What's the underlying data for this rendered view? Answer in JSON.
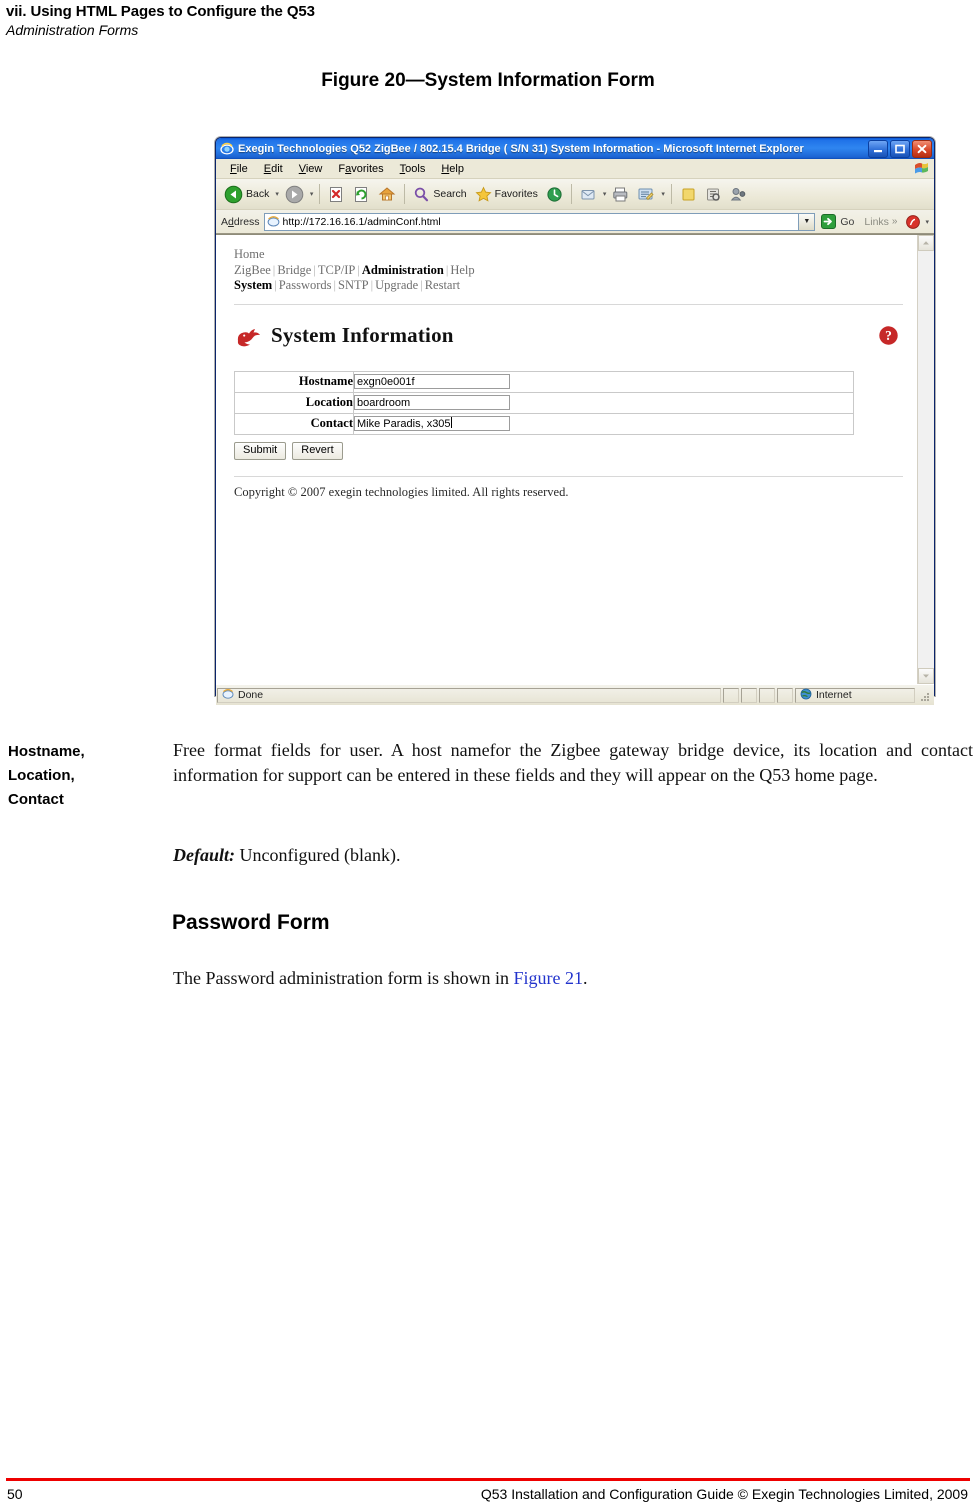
{
  "document": {
    "running_head_title": "vii. Using HTML Pages to Configure the Q53",
    "running_head_subtitle": "Administration Forms",
    "figure_caption": "Figure 20—System Information Form",
    "term_label_line1": "Hostname,",
    "term_label_line2": "Location,",
    "term_label_line3": "Contact",
    "body_paragraph": "Free format fields for user. A host namefor the Zigbee gateway bridge device, its location and contact information for support can be entered in these fields and they will appear on the Q53 home page.",
    "default_label": "Default:",
    "default_value": "Unconfigured (blank).",
    "section_heading": "Password Form",
    "after_paragraph_before_link": "The Password administration form is shown in ",
    "after_paragraph_link": "Figure 21",
    "after_paragraph_after_link": ".",
    "footer_page_number": "50",
    "footer_text": "Q53 Installation and Configuration Guide  © Exegin Technologies Limited, 2009",
    "accent_color": "#ee0000",
    "link_color": "#2233cc"
  },
  "browser": {
    "title": "Exegin Technologies Q52 ZigBee / 802.15.4 Bridge ( S/N 31) System Information - Microsoft Internet Explorer",
    "window_buttons": {
      "minimize": "–",
      "maximize": "□",
      "close": "✕"
    },
    "menu": [
      {
        "label": "File",
        "accel": "F",
        "rest": "ile"
      },
      {
        "label": "Edit",
        "accel": "E",
        "rest": "dit"
      },
      {
        "label": "View",
        "accel": "V",
        "rest": "iew"
      },
      {
        "label": "Favorites",
        "accel": "F",
        "rest": "avorites"
      },
      {
        "label": "Tools",
        "accel": "T",
        "rest": "ools"
      },
      {
        "label": "Help",
        "accel": "H",
        "rest": "elp"
      }
    ],
    "toolbar": {
      "back_label": "Back",
      "forward_label": "",
      "stop_label": "",
      "refresh_label": "",
      "home_label": "",
      "search_label": "Search",
      "favorites_label": "Favorites",
      "history_label": "",
      "mail_label": "",
      "print_label": "",
      "edit_label": "",
      "discuss_label": "",
      "research_label": "",
      "messenger_label": ""
    },
    "address": {
      "label": "Address",
      "url": "http://172.16.16.1/adminConf.html",
      "go_label": "Go",
      "links_label": "Links"
    },
    "statusbar": {
      "status": "Done",
      "zone": "Internet"
    }
  },
  "webpage": {
    "nav": {
      "home": "Home",
      "primary": [
        {
          "label": "ZigBee",
          "current": false
        },
        {
          "label": "Bridge",
          "current": false
        },
        {
          "label": "TCP/IP",
          "current": false
        },
        {
          "label": "Administration",
          "current": true
        },
        {
          "label": "Help",
          "current": false
        }
      ],
      "secondary": [
        {
          "label": "System",
          "current": true
        },
        {
          "label": "Passwords",
          "current": false
        },
        {
          "label": "SNTP",
          "current": false
        },
        {
          "label": "Upgrade",
          "current": false
        },
        {
          "label": "Restart",
          "current": false
        }
      ],
      "separator": "|"
    },
    "heading": "System Information",
    "form": {
      "fields": [
        {
          "label": "Hostname",
          "value": "exgn0e001f",
          "focused": false
        },
        {
          "label": "Location",
          "value": "boardroom",
          "focused": false
        },
        {
          "label": "Contact",
          "value": "Mike Paradis, x305",
          "focused": true
        }
      ],
      "submit_label": "Submit",
      "revert_label": "Revert"
    },
    "copyright": "Copyright © 2007 exegin technologies limited. All rights reserved."
  }
}
